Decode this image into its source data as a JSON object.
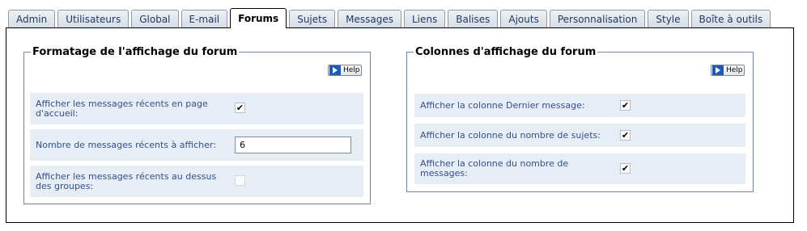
{
  "tabs": [
    {
      "label": "Admin",
      "active": false
    },
    {
      "label": "Utilisateurs",
      "active": false
    },
    {
      "label": "Global",
      "active": false
    },
    {
      "label": "E-mail",
      "active": false
    },
    {
      "label": "Forums",
      "active": true
    },
    {
      "label": "Sujets",
      "active": false
    },
    {
      "label": "Messages",
      "active": false
    },
    {
      "label": "Liens",
      "active": false
    },
    {
      "label": "Balises",
      "active": false
    },
    {
      "label": "Ajouts",
      "active": false
    },
    {
      "label": "Personnalisation",
      "active": false
    },
    {
      "label": "Style",
      "active": false
    },
    {
      "label": "Boîte à outils",
      "active": false
    }
  ],
  "left_group": {
    "title": "Formatage de l'affichage du forum",
    "help_label": "Help",
    "rows": [
      {
        "label": "Afficher les messages récents en page d'accueil:",
        "checked": true
      },
      {
        "label": "Nombre de messages récents à afficher:",
        "value": "6"
      },
      {
        "label": "Afficher les messages récents au dessus des groupes:",
        "checked": false
      }
    ]
  },
  "right_group": {
    "title": "Colonnes d'affichage du forum",
    "help_label": "Help",
    "rows": [
      {
        "label": "Afficher la colonne Dernier message:",
        "checked": true
      },
      {
        "label": "Afficher la colonne du nombre de sujets:",
        "checked": true
      },
      {
        "label": "Afficher la colonne du nombre de messages:",
        "checked": true
      }
    ]
  },
  "glyphs": {
    "check_mark": "✔"
  },
  "colors": {
    "tab_text": "#1f3a66",
    "row_bg": "#e6edf5",
    "label_text": "#33508a",
    "fieldset_border": "#6f86ab"
  }
}
